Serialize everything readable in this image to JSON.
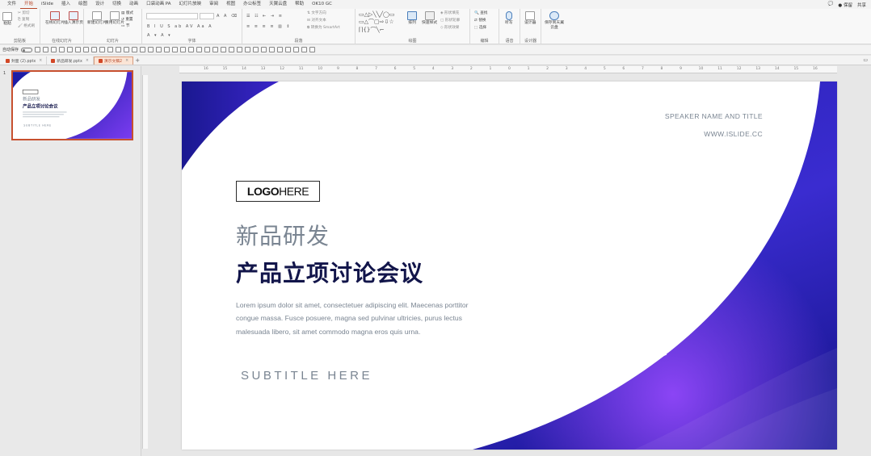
{
  "menu": {
    "tabs": [
      "文件",
      "开始",
      "iSlide",
      "插入",
      "绘图",
      "设计",
      "切换",
      "动画",
      "口袋动画 PA",
      "幻灯片放映",
      "审阅",
      "视图",
      "办公标签",
      "天翼云盘",
      "帮助",
      "OK10 GC"
    ],
    "active_index": 1,
    "right": {
      "comment": "💬",
      "share_mode": "● 保留",
      "share": "共享"
    }
  },
  "ribbon": {
    "clipboard": {
      "label": "剪贴板",
      "paste": "粘贴",
      "cut": "剪切",
      "copy": "复制",
      "format_painter": "格式刷"
    },
    "online": {
      "label": "在线幻灯片",
      "online_btn": "在线幻灯片",
      "insert_btn": "插入演示页"
    },
    "slides": {
      "label": "幻灯片",
      "new_slide": "新建幻灯片",
      "reuse": "重用幻灯片",
      "layout": "版式",
      "reset": "重置",
      "section": "节"
    },
    "font": {
      "label": "字体"
    },
    "paragraph": {
      "label": "段落",
      "text_direction": "文字方向",
      "align_text": "对齐文本",
      "smartart": "转换为 SmartArt"
    },
    "drawing": {
      "label": "绘图",
      "arrange": "排列",
      "quick_styles": "快速样式",
      "fill": "形状填充",
      "outline": "形状轮廓",
      "effects": "形状效果"
    },
    "editing": {
      "label": "编辑",
      "find": "查找",
      "replace": "替换",
      "select": "选择"
    },
    "voice": {
      "label": "语音",
      "dictate": "听写"
    },
    "designer": {
      "label": "设计器",
      "design_ideas": "设计器"
    },
    "cloud": {
      "label": "",
      "save_cloud": "保存到天翼云盘"
    }
  },
  "qat": {
    "autosave": "自动保存",
    "state": "关"
  },
  "doctabs": [
    {
      "name": "封面 (2).pptx",
      "active": false
    },
    {
      "name": "新品研发.pptx",
      "active": false
    },
    {
      "name": "演示文稿2",
      "active": true
    }
  ],
  "slide_number": "1",
  "ruler_ticks": [
    "16",
    "15",
    "14",
    "13",
    "12",
    "11",
    "10",
    "9",
    "8",
    "7",
    "6",
    "5",
    "4",
    "3",
    "2",
    "1",
    "0",
    "1",
    "2",
    "3",
    "4",
    "5",
    "6",
    "7",
    "8",
    "9",
    "10",
    "11",
    "12",
    "13",
    "14",
    "15",
    "16"
  ],
  "slide": {
    "speaker": "SPEAKER NAME AND TITLE",
    "website": "WWW.ISLIDE.CC",
    "logo_bold": "LOGO",
    "logo_regular": " HERE",
    "subtitle_cn": "新品研发",
    "title_cn": "产品立项讨论会议",
    "body": "Lorem ipsum dolor sit amet, consectetuer adipiscing elit. Maecenas porttitor congue massa. Fusce posuere, magna sed pulvinar ultricies, purus lectus malesuada libero, sit amet commodo magna eros quis urna.",
    "subtitle_en": "SUBTITLE HERE"
  },
  "thumb": {
    "logo": "LOGO HERE",
    "subtitle_cn": "新品研发",
    "title_cn": "产品立项讨论会议",
    "subtitle_en": "SUBTITLE HERE"
  },
  "colors": {
    "accent": "#b7472a",
    "deep_blue": "#1d1ca6",
    "purple": "#7a3cf0",
    "title_navy": "#12154a",
    "gray_text": "#7a8592"
  }
}
